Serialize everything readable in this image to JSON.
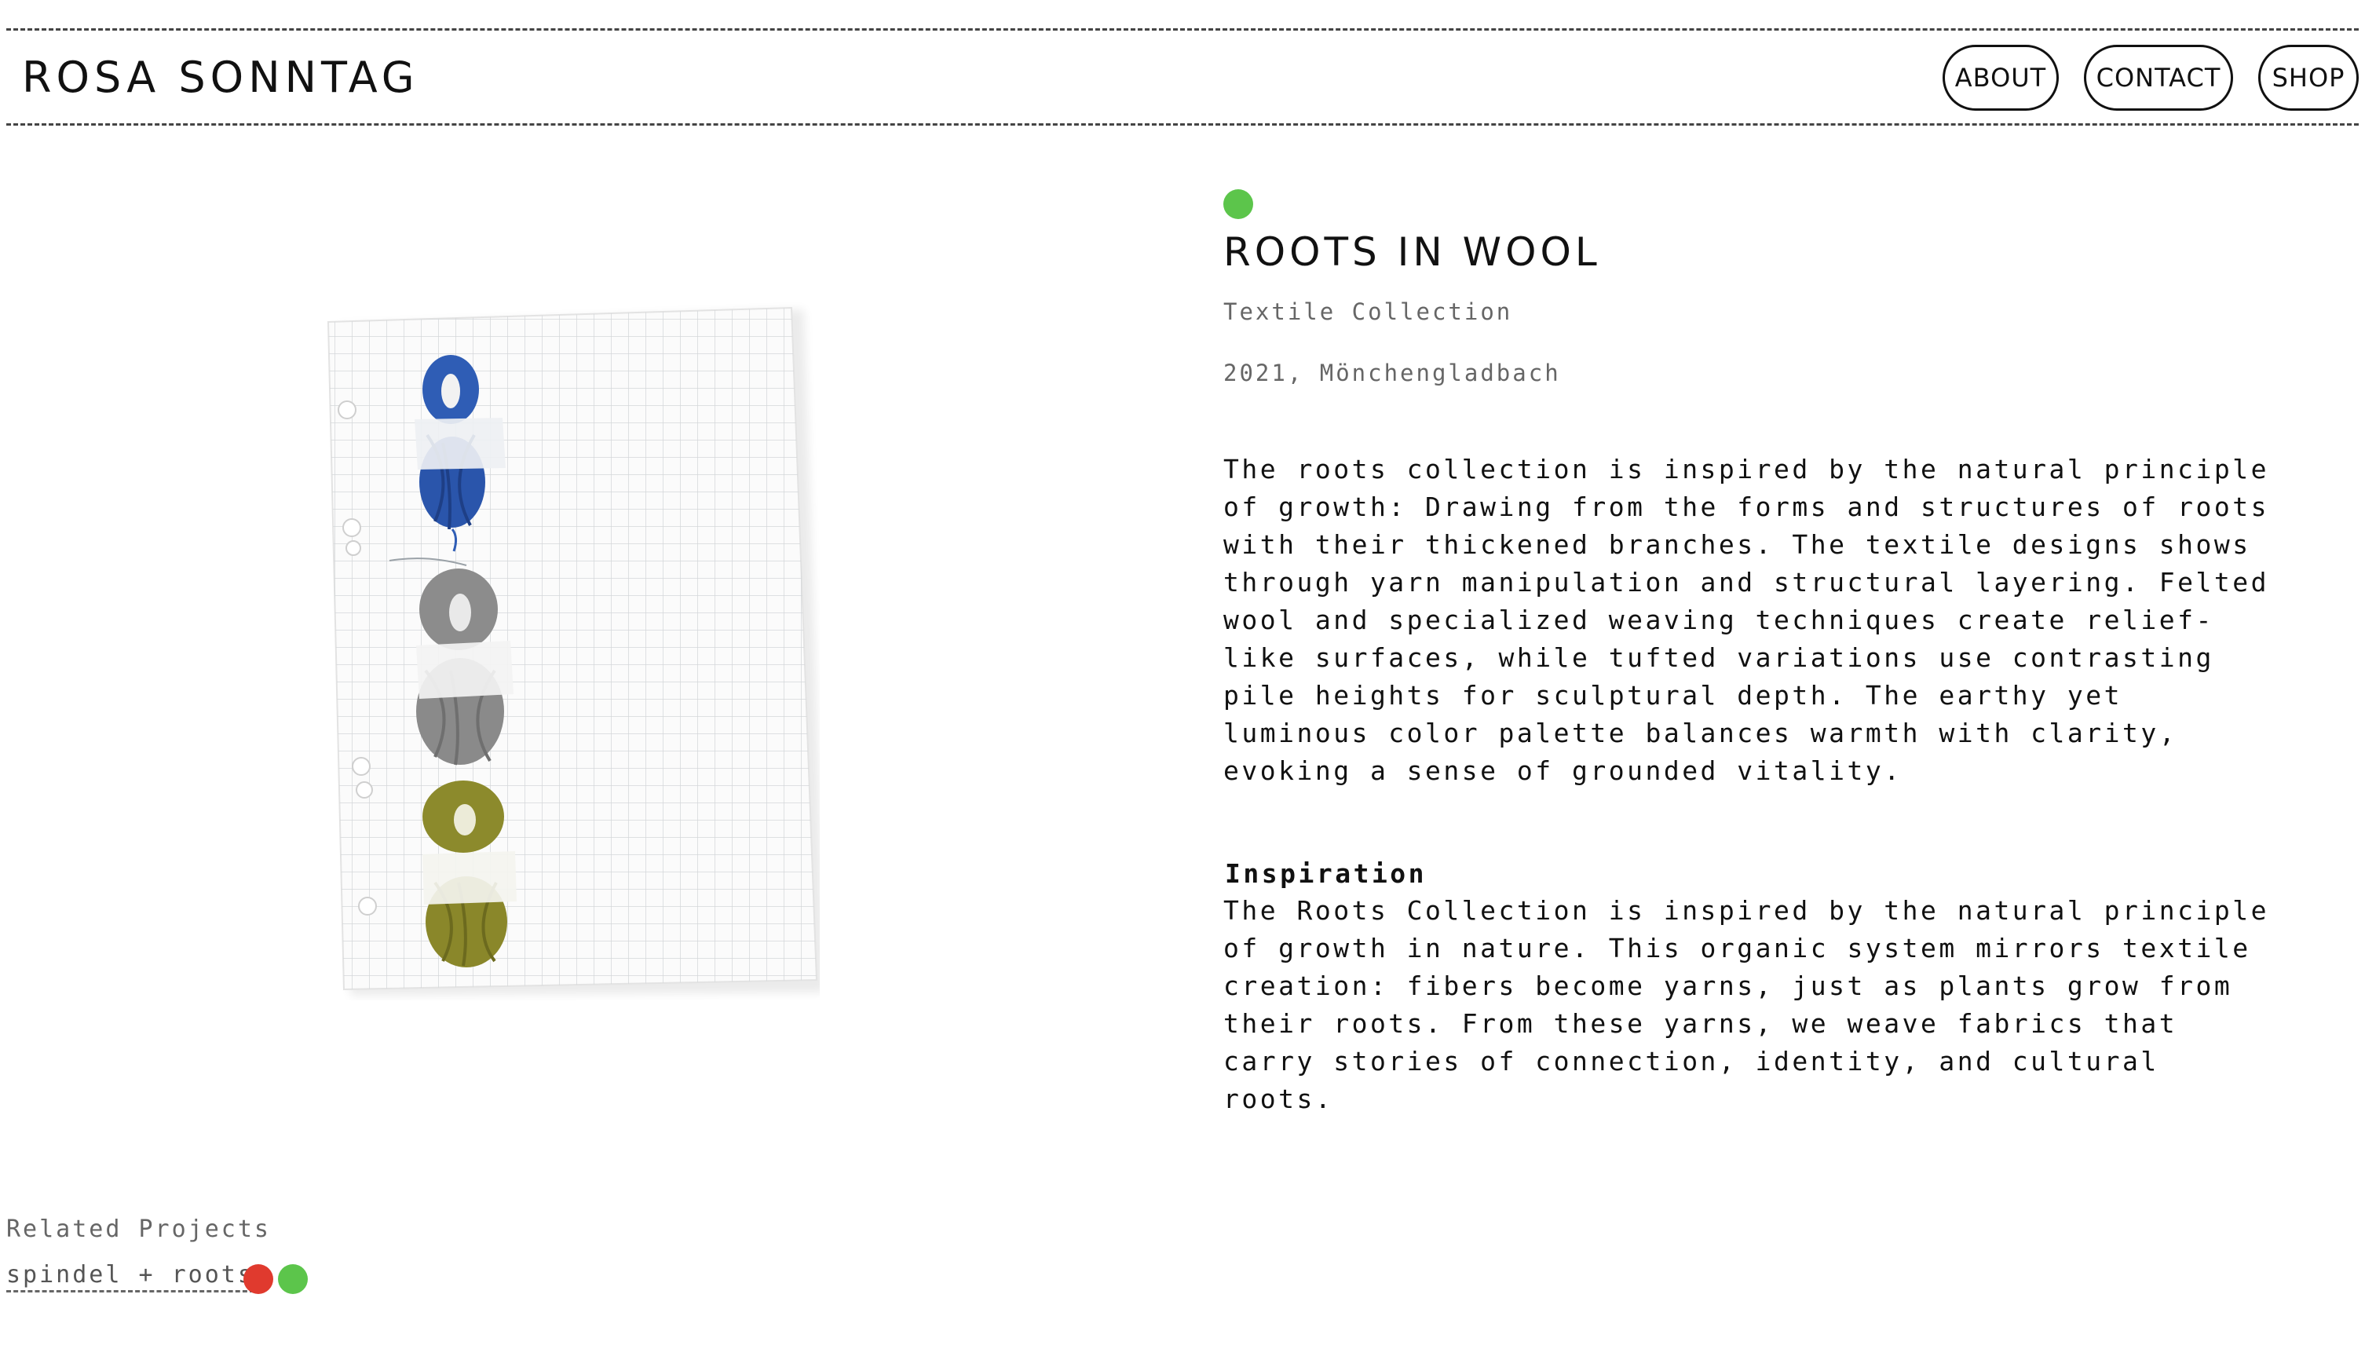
{
  "header": {
    "logo": "ROSA SONNTAG",
    "nav": [
      {
        "label": "ABOUT"
      },
      {
        "label": "CONTACT"
      },
      {
        "label": "SHOP"
      }
    ]
  },
  "project": {
    "status_color": "#5cc54b",
    "title": "ROOTS IN WOOL",
    "subtitle": "Textile Collection",
    "meta": "2021, Mönchengladbach",
    "description_lines": [
      "The roots collection is inspired by the natural principle",
      "of growth: Drawing from the forms and structures of roots",
      "with their thickened branches. The textile designs shows",
      "through yarn manipulation and structural layering. Felted",
      "wool and specialized weaving techniques create relief-",
      "like surfaces, while tufted variations use contrasting",
      "pile heights for sculptural depth. The earthy yet",
      "luminous color palette balances warmth with clarity,",
      "evoking a sense of grounded vitality."
    ],
    "inspiration_heading": "Inspiration",
    "inspiration_lines": [
      "The Roots Collection is inspired by the natural principle",
      "of growth in nature. This organic system mirrors textile",
      "creation: fibers become yarns, just as plants grow from",
      "their roots. From these yarns, we weave fabrics that",
      "carry stories of connection, identity, and cultural",
      "roots."
    ]
  },
  "related": {
    "label": "Related Projects",
    "link": "spindel + roots",
    "tag_colors": [
      "#e03a2e",
      "#5cc54b"
    ]
  },
  "image": {
    "yarn_colors": [
      "#2f5db5",
      "#8c8c8c",
      "#8c8a2c"
    ]
  }
}
